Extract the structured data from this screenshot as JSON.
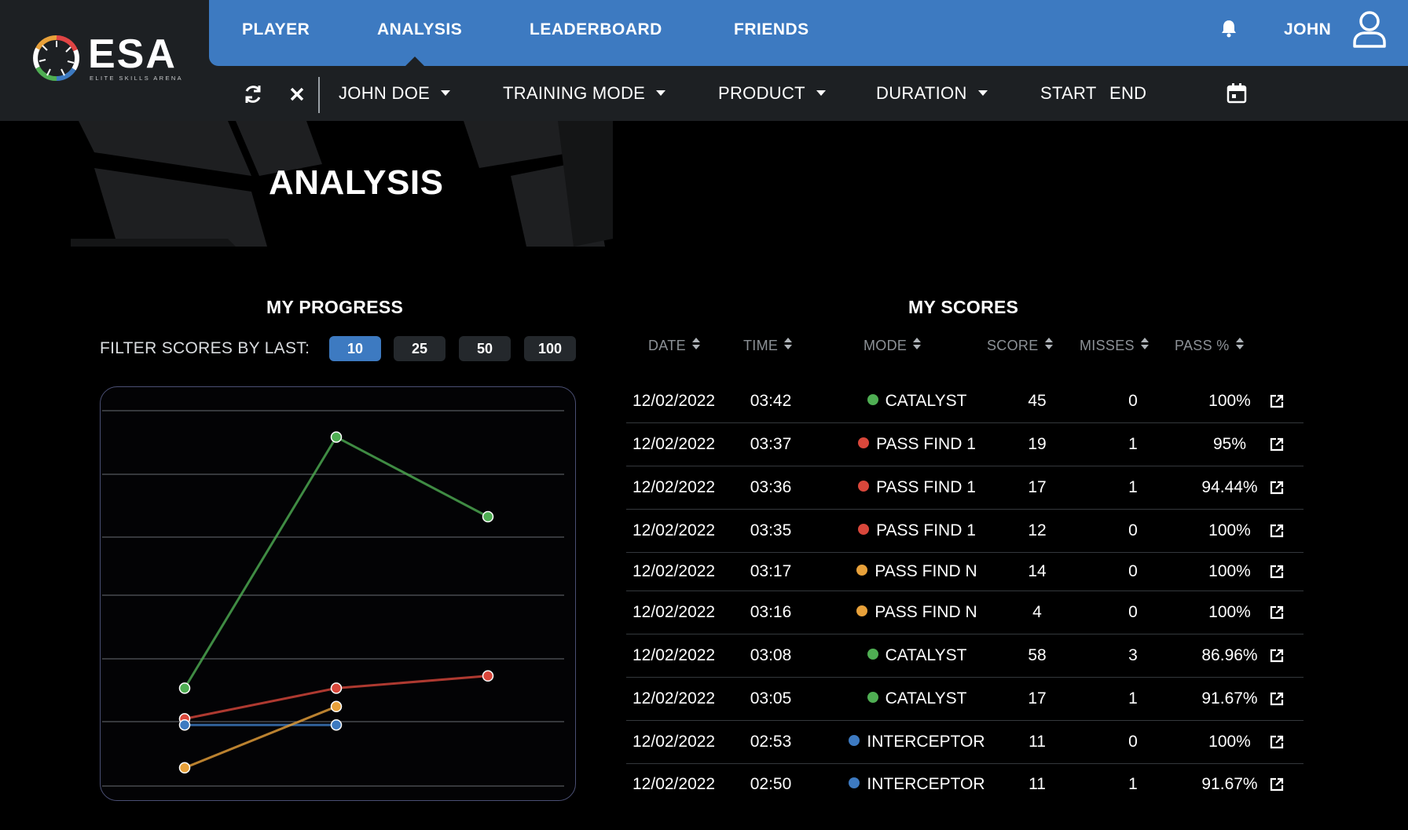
{
  "brand": {
    "wordmark": "ESA",
    "tagline": "ELITE SKILLS ARENA"
  },
  "nav": {
    "items": [
      "PLAYER",
      "ANALYSIS",
      "LEADERBOARD",
      "FRIENDS"
    ],
    "active": "ANALYSIS",
    "username": "JOHN",
    "icons": {
      "notifications": "bell-icon",
      "profile": "user-icon"
    }
  },
  "filters": {
    "player": "JOHN DOE",
    "training_mode": "TRAINING MODE",
    "product": "PRODUCT",
    "duration": "DURATION",
    "start": "START",
    "end": "END",
    "icons": {
      "refresh": "refresh-icon",
      "clear": "close-icon",
      "calendar": "calendar-icon"
    }
  },
  "page": {
    "title": "ANALYSIS"
  },
  "progress": {
    "title": "MY PROGRESS",
    "filter_label": "FILTER SCORES BY LAST:",
    "filter_options": [
      "10",
      "25",
      "50",
      "100"
    ],
    "filter_selected": "10"
  },
  "chart_data": {
    "type": "line",
    "grid": true,
    "legend": "none",
    "x": [
      1,
      2,
      3
    ],
    "ylim": [
      0,
      60
    ],
    "series": [
      {
        "color": "#4fae53",
        "points": [
          [
            1,
            17
          ],
          [
            2,
            58
          ],
          [
            3,
            45
          ]
        ]
      },
      {
        "color": "#d9473b",
        "points": [
          [
            1,
            12
          ],
          [
            2,
            17
          ],
          [
            3,
            19
          ]
        ]
      },
      {
        "color": "#3d7ac1",
        "points": [
          [
            1,
            11
          ],
          [
            2,
            11
          ]
        ]
      },
      {
        "color": "#e8a13a",
        "points": [
          [
            1,
            4
          ],
          [
            2,
            14
          ]
        ]
      }
    ]
  },
  "scores": {
    "title": "MY SCORES",
    "columns": [
      "DATE",
      "TIME",
      "MODE",
      "SCORE",
      "MISSES",
      "PASS %"
    ],
    "mode_colors": {
      "CATALYST": "#4fae53",
      "PASS FIND 1": "#d9473b",
      "PASS FIND N": "#e8a13a",
      "INTERCEPTOR": "#3d7ac1"
    },
    "rows": [
      {
        "date": "12/02/2022",
        "time": "03:42",
        "mode": "CATALYST",
        "score": "45",
        "misses": "0",
        "pass": "100%"
      },
      {
        "date": "12/02/2022",
        "time": "03:37",
        "mode": "PASS FIND 1",
        "score": "19",
        "misses": "1",
        "pass": "95%"
      },
      {
        "date": "12/02/2022",
        "time": "03:36",
        "mode": "PASS FIND 1",
        "score": "17",
        "misses": "1",
        "pass": "94.44%"
      },
      {
        "date": "12/02/2022",
        "time": "03:35",
        "mode": "PASS FIND 1",
        "score": "12",
        "misses": "0",
        "pass": "100%"
      },
      {
        "date": "12/02/2022",
        "time": "03:17",
        "mode": "PASS FIND N",
        "score": "14",
        "misses": "0",
        "pass": "100%"
      },
      {
        "date": "12/02/2022",
        "time": "03:16",
        "mode": "PASS FIND N",
        "score": "4",
        "misses": "0",
        "pass": "100%"
      },
      {
        "date": "12/02/2022",
        "time": "03:08",
        "mode": "CATALYST",
        "score": "58",
        "misses": "3",
        "pass": "86.96%"
      },
      {
        "date": "12/02/2022",
        "time": "03:05",
        "mode": "CATALYST",
        "score": "17",
        "misses": "1",
        "pass": "91.67%"
      },
      {
        "date": "12/02/2022",
        "time": "02:53",
        "mode": "INTERCEPTOR",
        "score": "11",
        "misses": "0",
        "pass": "100%"
      },
      {
        "date": "12/02/2022",
        "time": "02:50",
        "mode": "INTERCEPTOR",
        "score": "11",
        "misses": "1",
        "pass": "91.67%"
      }
    ],
    "row_action_icon": "external-link-icon"
  }
}
